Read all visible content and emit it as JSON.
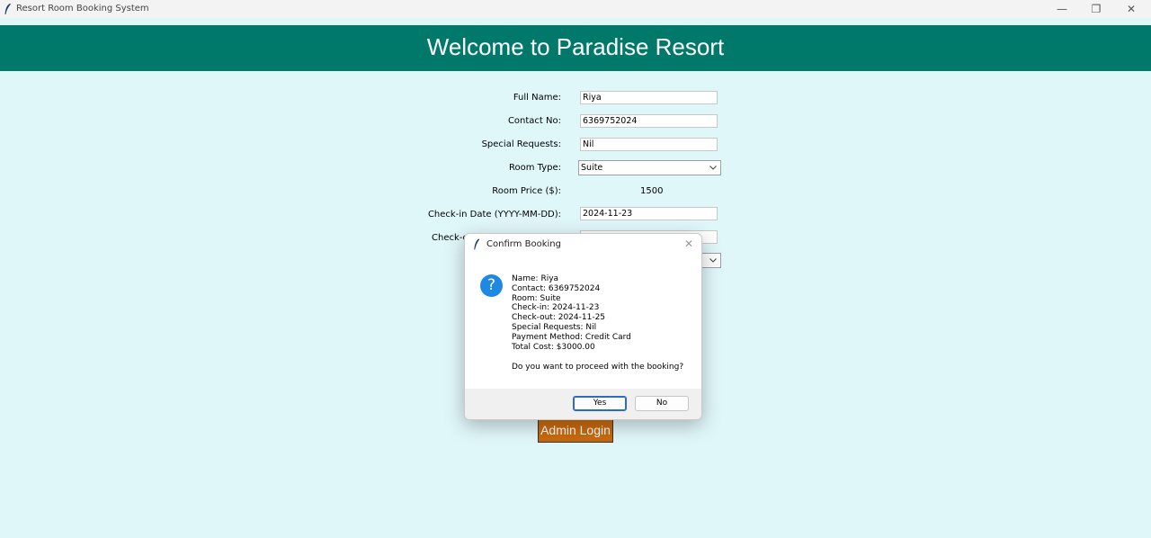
{
  "window": {
    "title": "Resort Room Booking System"
  },
  "header": {
    "title": "Welcome to Paradise Resort"
  },
  "form": {
    "full_name_label": "Full Name:",
    "full_name_value": "Riya",
    "contact_label": "Contact No:",
    "contact_value": "6369752024",
    "special_label": "Special Requests:",
    "special_value": "Nil",
    "room_type_label": "Room Type:",
    "room_type_value": "Suite",
    "room_price_label": "Room Price ($):",
    "room_price_value": "1500",
    "checkin_label": "Check-in Date (YYYY-MM-DD):",
    "checkin_value": "2024-11-23",
    "checkout_label_partial": "Check-o"
  },
  "admin_button": "Admin Login",
  "dialog": {
    "title": "Confirm Booking",
    "lines": [
      "Name: Riya",
      "Contact: 6369752024",
      "Room: Suite",
      "Check-in: 2024-11-23",
      "Check-out: 2024-11-25",
      "Special Requests: Nil",
      "Payment Method: Credit Card",
      "Total Cost: $3000.00"
    ],
    "question": "Do you want to proceed with the booking?",
    "yes_label": "Yes",
    "no_label": "No"
  },
  "colors": {
    "background": "#e0f7fa",
    "header": "#00796b",
    "admin_button": "#c96a0e",
    "question_icon": "#1e88e5"
  }
}
